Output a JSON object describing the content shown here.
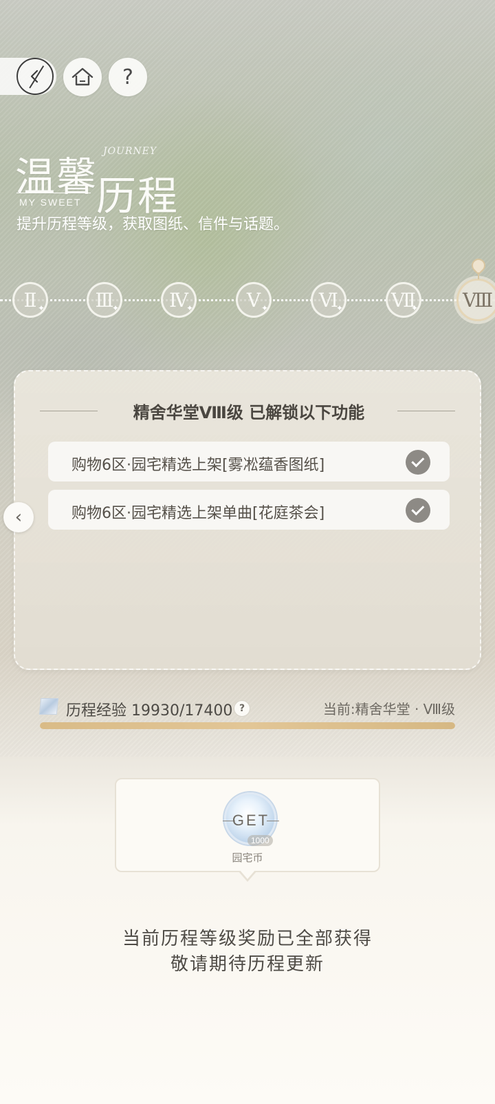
{
  "header": {
    "title_line1": "温馨",
    "title_line2": "历程",
    "title_en": "MY SWEET",
    "title_script": "JOURNEY",
    "subtitle": "提升历程等级，获取图纸、信件与话题。",
    "help_label": "?"
  },
  "levels": [
    {
      "label": "Ⅱ"
    },
    {
      "label": "Ⅲ"
    },
    {
      "label": "Ⅳ"
    },
    {
      "label": "Ⅴ"
    },
    {
      "label": "Ⅵ"
    },
    {
      "label": "Ⅶ"
    },
    {
      "label": "Ⅷ",
      "current": true
    }
  ],
  "panel": {
    "title": "精舍华堂Ⅷ级  已解锁以下功能",
    "items": [
      {
        "label": "购物6区·园宅精选上架[雾凇蕴香图纸]",
        "checked": true
      },
      {
        "label": "购物6区·园宅精选上架单曲[花庭茶会]",
        "checked": true
      }
    ],
    "prev_arrow": "‹"
  },
  "experience": {
    "label": "历程经验 19930/17400",
    "current": 19930,
    "max": 17400,
    "fill_fraction": 1.0,
    "help_label": "?",
    "current_level": "当前:精舍华堂 · Ⅷ级"
  },
  "reward": {
    "badge_text": "GET",
    "count": "1000",
    "name": "园宅币"
  },
  "footer": {
    "line1": "当前历程等级奖励已全部获得",
    "line2": "敬请期待历程更新"
  },
  "colors": {
    "accent_gold": "#d9bb87",
    "check_gray": "#8d8a85",
    "text_dark": "#4e4b46"
  },
  "icons": {
    "back": "back-icon",
    "home": "home-icon",
    "help": "help-icon",
    "check": "check-icon",
    "exp": "experience-icon",
    "coin": "coin-icon",
    "pin": "location-pin-icon"
  }
}
